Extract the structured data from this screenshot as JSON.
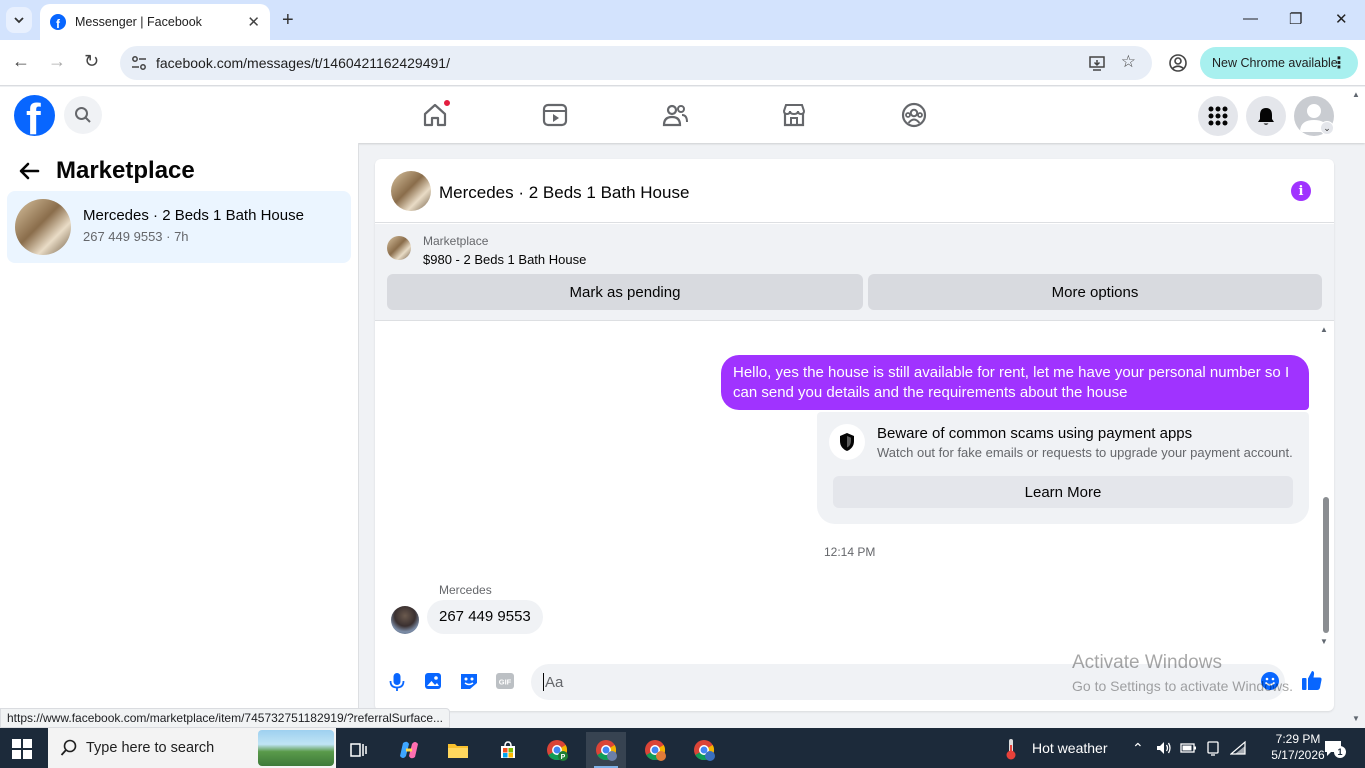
{
  "browser": {
    "tab_title": "Messenger | Facebook",
    "url": "facebook.com/messages/t/1460421162429491/",
    "new_chrome_label": "New Chrome available",
    "status_url": "https://www.facebook.com/marketplace/item/745732751182919/?referralSurface..."
  },
  "sidebar": {
    "title": "Marketplace",
    "conversations": [
      {
        "name": "Mercedes · 2 Beds 1 Bath House",
        "subtitle": "267 449 9553 · 7h"
      }
    ]
  },
  "chat": {
    "title": "Mercedes · 2 Beds 1 Bath House",
    "listing": {
      "source": "Marketplace",
      "price_title": "$980 - 2 Beds 1 Bath House",
      "mark_pending_label": "Mark as pending",
      "more_options_label": "More options"
    },
    "outgoing_message": "Hello, yes the house is still available for rent, let me have your personal number so I can send you details and the requirements about the house",
    "warning": {
      "title": "Beware of common scams using payment apps",
      "body": "Watch out for fake emails or requests to upgrade your payment account.",
      "button": "Learn More"
    },
    "timestamp": "12:14 PM",
    "incoming_sender": "Mercedes",
    "incoming_message": "267 449 9553",
    "composer_placeholder": "Aa"
  },
  "watermark": {
    "line1": "Activate Windows",
    "line2": "Go to Settings to activate Windows."
  },
  "taskbar": {
    "search_placeholder": "Type here to search",
    "weather": "Hot weather",
    "time": "7:29 PM",
    "date": "5/17/2026",
    "notification_count": "1"
  },
  "colors": {
    "facebook_blue": "#0866ff",
    "messenger_purple": "#a033ff",
    "selected_conversation_bg": "#ebf5ff"
  }
}
